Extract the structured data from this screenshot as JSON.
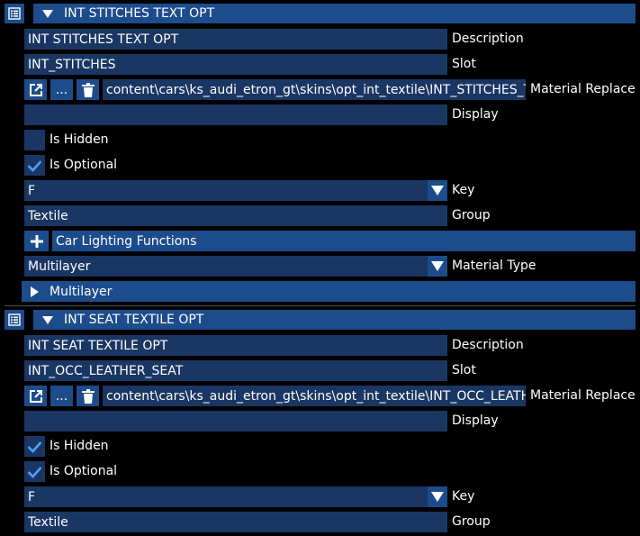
{
  "sections": [
    {
      "title": "INT STITCHES TEXT OPT",
      "description_value": "INT STITCHES TEXT OPT",
      "description_label": "Description",
      "slot_value": "INT_STITCHES",
      "slot_label": "Slot",
      "open_button_icon": "external-link-icon",
      "browse_button_label": "...",
      "delete_button_icon": "trash-icon",
      "material_replace_value": "content\\cars\\ks_audi_etron_gt\\skins\\opt_int_textile\\INT_STITCHES_T",
      "material_replace_label": "Material Replace",
      "display_value": "",
      "display_label": "Display",
      "is_hidden_label": "Is Hidden",
      "is_hidden_checked": false,
      "is_optional_label": "Is Optional",
      "is_optional_checked": true,
      "key_value": "F",
      "key_label": "Key",
      "group_value": "Textile",
      "group_label": "Group",
      "car_lighting_label": "Car Lighting Functions",
      "material_type_value": "Multilayer",
      "material_type_label": "Material Type",
      "multilayer_label": "Multilayer"
    },
    {
      "title": "INT SEAT TEXTILE OPT",
      "description_value": "INT SEAT TEXTILE OPT",
      "description_label": "Description",
      "slot_value": "INT_OCC_LEATHER_SEAT",
      "slot_label": "Slot",
      "browse_button_label": "...",
      "material_replace_value": "content\\cars\\ks_audi_etron_gt\\skins\\opt_int_textile\\INT_OCC_LEATH",
      "material_replace_label": "Material Replace",
      "display_value": "",
      "display_label": "Display",
      "is_hidden_label": "Is Hidden",
      "is_hidden_checked": true,
      "is_optional_label": "Is Optional",
      "is_optional_checked": true,
      "key_value": "F",
      "key_label": "Key",
      "group_value": "Textile",
      "group_label": "Group"
    }
  ],
  "colors": {
    "header_bg": "#1d4c8c",
    "field_bg": "#1a3663",
    "background": "#000000",
    "check_color": "#4ea1ff"
  }
}
